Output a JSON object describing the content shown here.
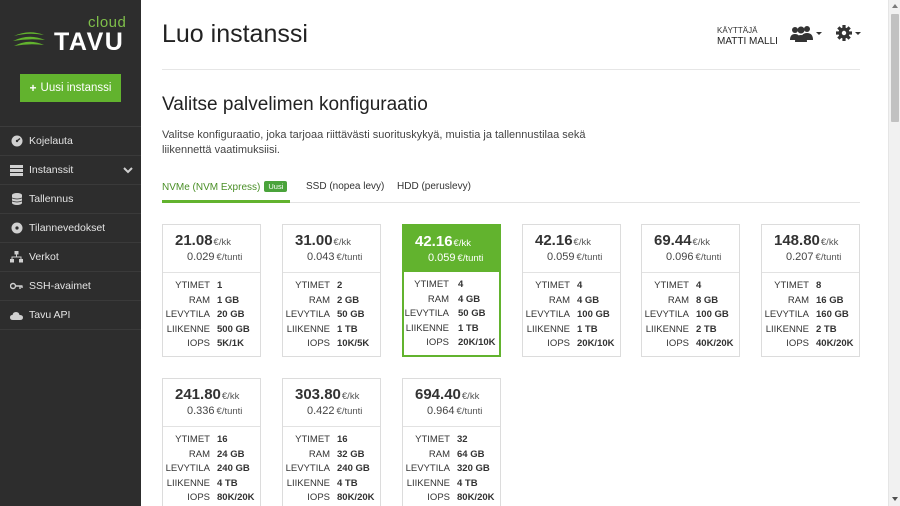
{
  "brand": {
    "cloud": "cloud",
    "name": "TAVU"
  },
  "sidebar": {
    "new_button": "Uusi instanssi",
    "items": [
      {
        "label": "Kojelauta",
        "icon": "dashboard-icon"
      },
      {
        "label": "Instanssit",
        "icon": "server-icon"
      },
      {
        "label": "Tallennus",
        "icon": "database-icon"
      },
      {
        "label": "Tilannevedokset",
        "icon": "disc-icon"
      },
      {
        "label": "Verkot",
        "icon": "network-icon"
      },
      {
        "label": "SSH-avaimet",
        "icon": "key-icon"
      },
      {
        "label": "Tavu API",
        "icon": "cloud-icon"
      }
    ]
  },
  "header": {
    "title": "Luo instanssi",
    "user_label": "KÄYTTÄJÄ",
    "user_name": "MATTI MALLI"
  },
  "section": {
    "title": "Valitse palvelimen konfiguraatio",
    "description": "Valitse konfiguraatio, joka tarjoaa riittävästi suorituskykyä, muistia ja tallennustilaa sekä liikennettä vaatimuksiisi."
  },
  "tabs": [
    {
      "label": "NVMe (NVM Express)",
      "badge": "Uusi",
      "active": true
    },
    {
      "label": "SSD (nopea levy)",
      "active": false
    },
    {
      "label": "HDD (peruslevy)",
      "active": false
    }
  ],
  "spec_labels": {
    "cores": "YTIMET",
    "ram": "RAM",
    "disk": "LEVYTILA",
    "traffic": "LIIKENNE",
    "iops": "IOPS"
  },
  "units": {
    "monthly": "€/kk",
    "hourly": "€/tunti"
  },
  "colors": {
    "accent": "#62b32e",
    "sidebar": "#2d2d2d"
  },
  "plans": [
    {
      "price": "21.08",
      "hourly": "0.029",
      "cores": "1",
      "ram": "1 GB",
      "disk": "20 GB",
      "traffic": "500 GB",
      "iops": "5K/1K",
      "selected": false
    },
    {
      "price": "31.00",
      "hourly": "0.043",
      "cores": "2",
      "ram": "2 GB",
      "disk": "50 GB",
      "traffic": "1 TB",
      "iops": "10K/5K",
      "selected": false
    },
    {
      "price": "42.16",
      "hourly": "0.059",
      "cores": "4",
      "ram": "4 GB",
      "disk": "50 GB",
      "traffic": "1 TB",
      "iops": "20K/10K",
      "selected": true
    },
    {
      "price": "42.16",
      "hourly": "0.059",
      "cores": "4",
      "ram": "4 GB",
      "disk": "100 GB",
      "traffic": "1 TB",
      "iops": "20K/10K",
      "selected": false
    },
    {
      "price": "69.44",
      "hourly": "0.096",
      "cores": "4",
      "ram": "8 GB",
      "disk": "100 GB",
      "traffic": "2 TB",
      "iops": "40K/20K",
      "selected": false
    },
    {
      "price": "148.80",
      "hourly": "0.207",
      "cores": "8",
      "ram": "16 GB",
      "disk": "160 GB",
      "traffic": "2 TB",
      "iops": "40K/20K",
      "selected": false
    },
    {
      "price": "241.80",
      "hourly": "0.336",
      "cores": "16",
      "ram": "24 GB",
      "disk": "240 GB",
      "traffic": "4 TB",
      "iops": "80K/20K",
      "selected": false
    },
    {
      "price": "303.80",
      "hourly": "0.422",
      "cores": "16",
      "ram": "32 GB",
      "disk": "240 GB",
      "traffic": "4 TB",
      "iops": "80K/20K",
      "selected": false
    },
    {
      "price": "694.40",
      "hourly": "0.964",
      "cores": "32",
      "ram": "64 GB",
      "disk": "320 GB",
      "traffic": "4 TB",
      "iops": "80K/20K",
      "selected": false
    }
  ]
}
